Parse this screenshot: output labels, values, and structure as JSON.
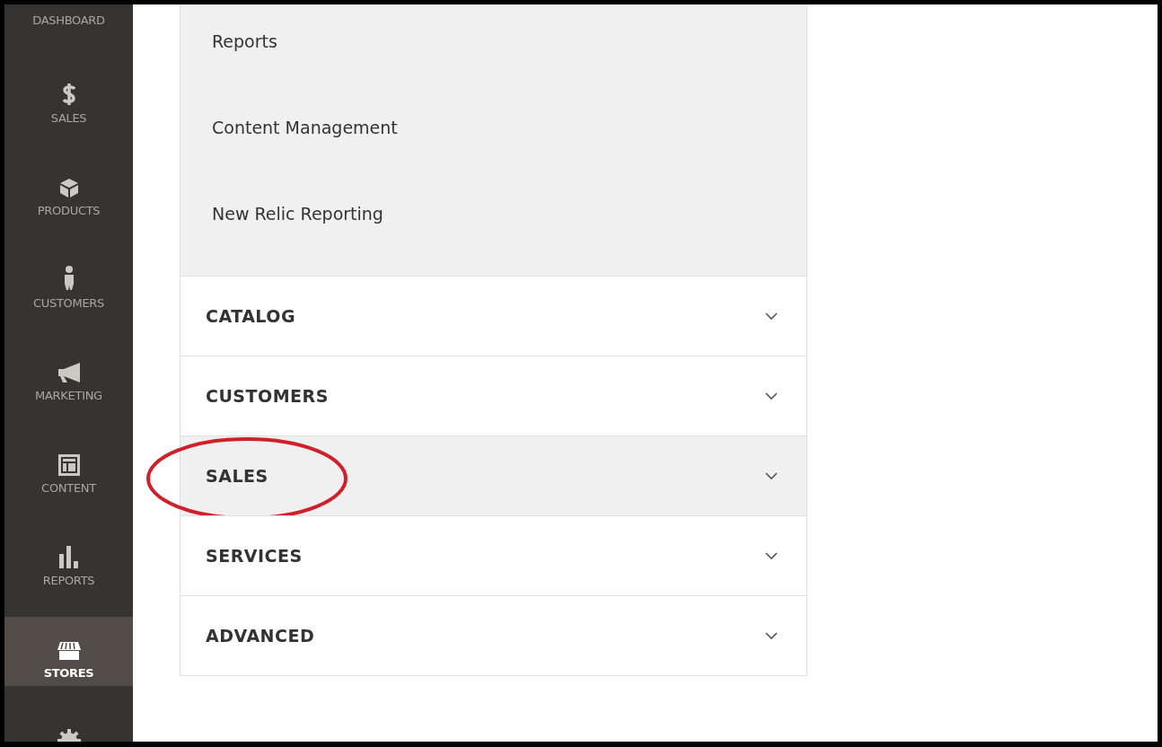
{
  "sidebar": {
    "items": [
      {
        "label": "DASHBOARD",
        "selected": false
      },
      {
        "label": "SALES",
        "selected": false
      },
      {
        "label": "PRODUCTS",
        "selected": false
      },
      {
        "label": "CUSTOMERS",
        "selected": false
      },
      {
        "label": "MARKETING",
        "selected": false
      },
      {
        "label": "CONTENT",
        "selected": false
      },
      {
        "label": "REPORTS",
        "selected": false
      },
      {
        "label": "STORES",
        "selected": true
      },
      {
        "selected": false
      }
    ]
  },
  "links": [
    "Reports",
    "Content Management",
    "New Relic Reporting"
  ],
  "sections": [
    {
      "title": "CATALOG",
      "highlighted": false,
      "circled": false
    },
    {
      "title": "CUSTOMERS",
      "highlighted": false,
      "circled": false
    },
    {
      "title": "SALES",
      "highlighted": true,
      "circled": true
    },
    {
      "title": "SERVICES",
      "highlighted": false,
      "circled": false
    },
    {
      "title": "ADVANCED",
      "highlighted": false,
      "circled": false
    }
  ]
}
